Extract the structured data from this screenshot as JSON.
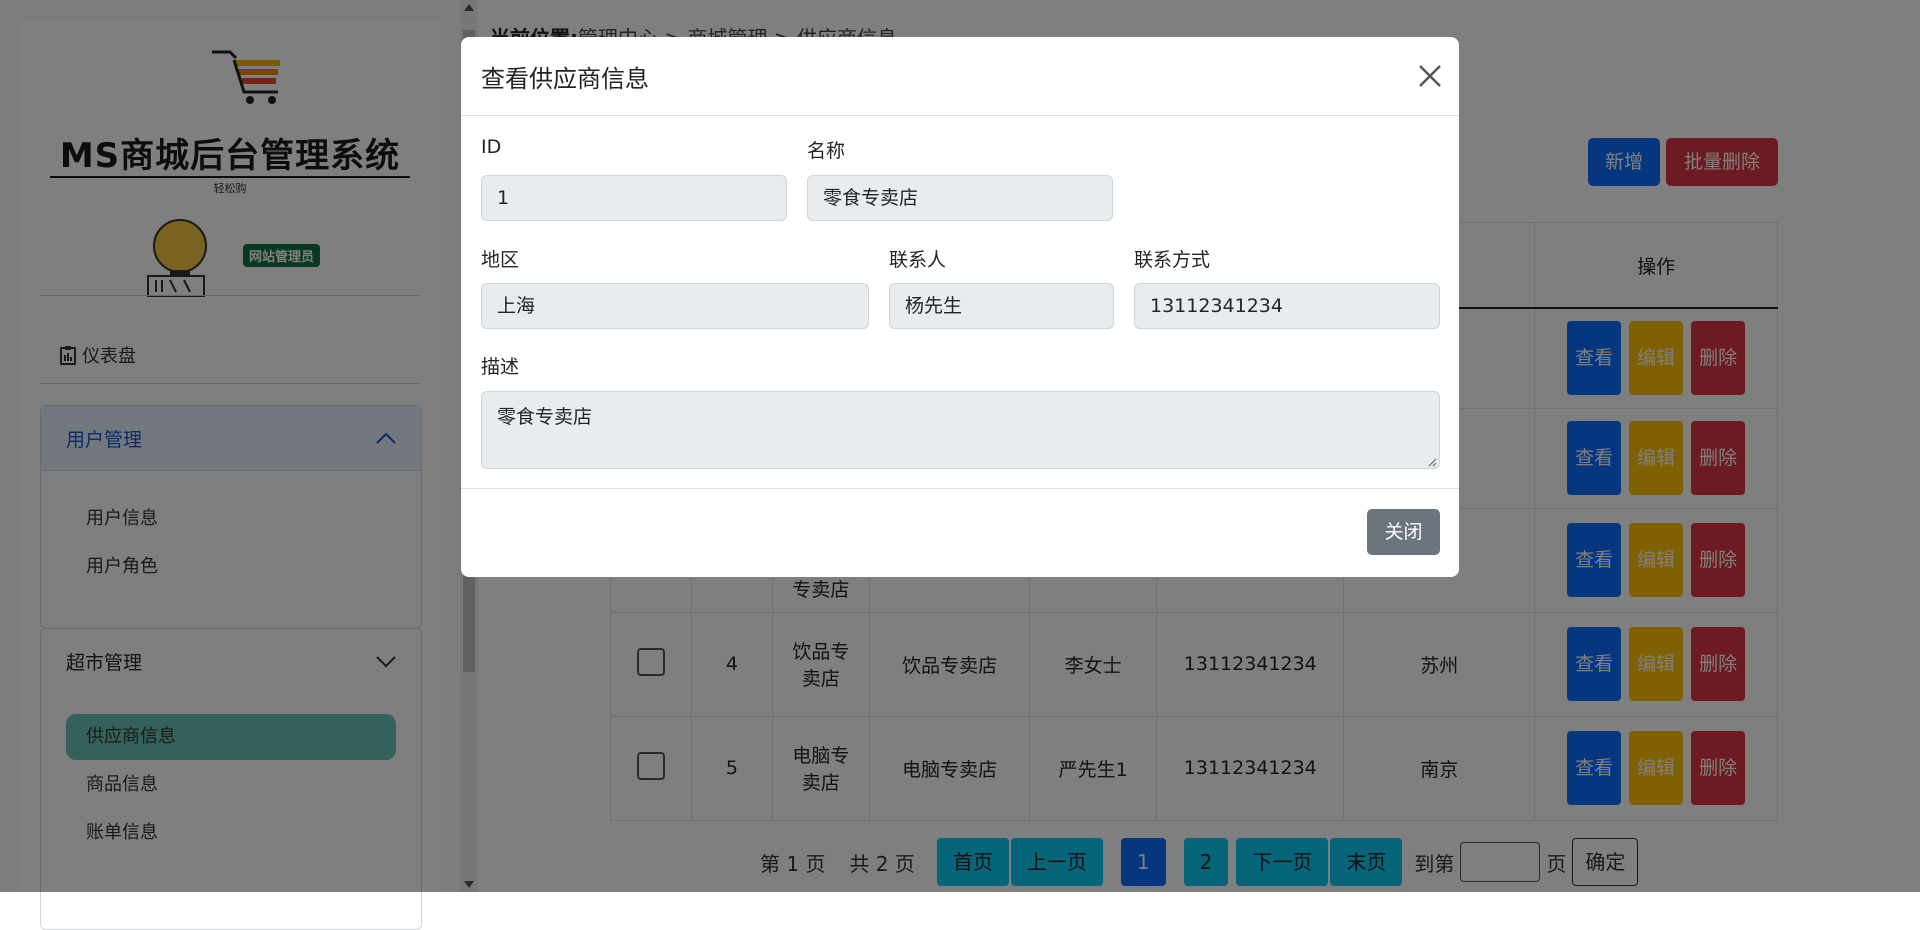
{
  "sidebar": {
    "logo_title": "MS商城后台管理系统",
    "logo_subtitle": "轻松购",
    "role_badge": "网站管理员",
    "dashboard_label": "仪表盘",
    "groups": [
      {
        "label": "用户管理",
        "expanded": true,
        "items": [
          {
            "label": "用户信息"
          },
          {
            "label": "用户角色"
          }
        ]
      },
      {
        "label": "超市管理",
        "expanded": true,
        "items": [
          {
            "label": "供应商信息",
            "selected": true
          },
          {
            "label": "商品信息"
          },
          {
            "label": "账单信息"
          }
        ]
      }
    ]
  },
  "breadcrumb": {
    "prefix": "当前位置:",
    "path": "管理中心 > 商城管理 > 供应商信息"
  },
  "toolbar": {
    "add_label": "新增",
    "batch_delete_label": "批量删除"
  },
  "table": {
    "header_action": "操作",
    "row_action_labels": {
      "view": "查看",
      "edit": "编辑",
      "delete": "删除"
    },
    "partial_cell": "专卖店",
    "rows": [
      {
        "id": "4",
        "short_name": "饮品专卖店",
        "name": "饮品专卖店",
        "contact": "李女士",
        "phone": "13112341234",
        "region": "苏州"
      },
      {
        "id": "5",
        "short_name": "电脑专卖店",
        "name": "电脑专卖店",
        "contact": "严先生1",
        "phone": "13112341234",
        "region": "南京"
      }
    ]
  },
  "pager": {
    "page_info": "第 1 页",
    "total_info": "共 2 页",
    "first": "首页",
    "prev": "上一页",
    "pages": [
      "1",
      "2"
    ],
    "current_page": "1",
    "next": "下一页",
    "last": "末页",
    "goto_prefix": "到第",
    "goto_suffix": "页",
    "confirm": "确定"
  },
  "modal": {
    "title": "查看供应商信息",
    "fields": {
      "id": {
        "label": "ID",
        "value": "1"
      },
      "name": {
        "label": "名称",
        "value": "零食专卖店"
      },
      "region": {
        "label": "地区",
        "value": "上海"
      },
      "contact": {
        "label": "联系人",
        "value": "杨先生"
      },
      "phone": {
        "label": "联系方式",
        "value": "13112341234"
      },
      "description": {
        "label": "描述",
        "value": "零食专卖店"
      }
    },
    "close_label": "关闭"
  },
  "colors": {
    "primary": "#0d6efd",
    "danger": "#dc3545",
    "warning": "#ffc107",
    "info": "#0dcaf0",
    "selected_nav": "#68c3b6",
    "badge": "#157347"
  }
}
